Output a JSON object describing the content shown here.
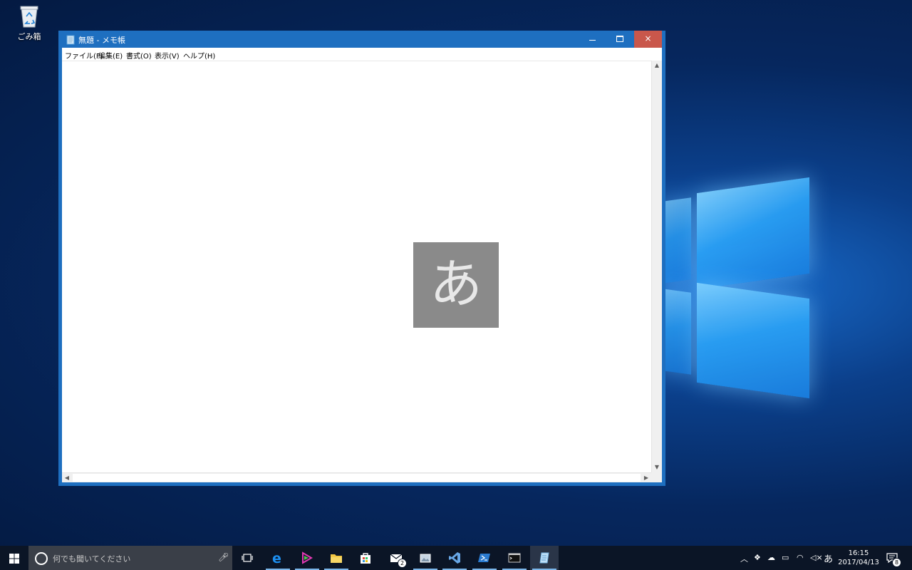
{
  "desktop": {
    "recycle_bin_label": "ごみ箱"
  },
  "window": {
    "title": "無題 - メモ帳",
    "close_label": "×",
    "menu": [
      "ファイル(F)",
      "編集(E)",
      "書式(O)",
      "表示(V)",
      "ヘルプ(H)"
    ],
    "content": ""
  },
  "ime_indicator": "あ",
  "taskbar": {
    "search_placeholder": "何でも聞いてください",
    "apps": [
      {
        "name": "task-view"
      },
      {
        "name": "edge"
      },
      {
        "name": "rstudio"
      },
      {
        "name": "file-explorer"
      },
      {
        "name": "store"
      },
      {
        "name": "mail",
        "badge": "2"
      },
      {
        "name": "photos"
      },
      {
        "name": "visual-studio"
      },
      {
        "name": "powershell"
      },
      {
        "name": "command-prompt"
      },
      {
        "name": "notepad"
      }
    ],
    "tray": {
      "ime_mode": "あ",
      "time": "16:15",
      "date": "2017/04/13",
      "notification_count": "8"
    }
  },
  "colors": {
    "titlebar": "#1e6fc0",
    "close_button": "#c9574b",
    "taskbar": "#0b1526"
  }
}
